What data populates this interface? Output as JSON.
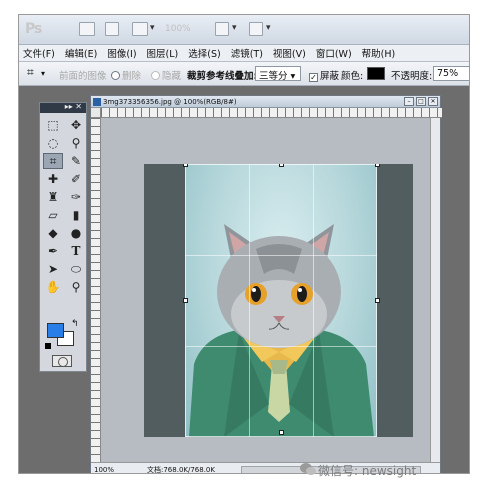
{
  "app": {
    "logo": "Ps",
    "zoom_value": "100%"
  },
  "menubar": {
    "items": [
      "文件(F)",
      "编辑(E)",
      "图像(I)",
      "图层(L)",
      "选择(S)",
      "滤镜(T)",
      "视图(V)",
      "窗口(W)",
      "帮助(H)"
    ]
  },
  "options": {
    "front_image_label": "前面的图像",
    "delete_label": "删除",
    "hide_label": "隐藏",
    "overlay_label": "裁剪参考线叠加:",
    "overlay_value": "三等分",
    "shield_label": "屏蔽",
    "color_label": "颜色:",
    "color_value": "#000000",
    "opacity_label": "不透明度:",
    "opacity_value": "75%"
  },
  "document": {
    "title": "3mg373356356.jpg @ 100%(RGB/8#)",
    "zoom": "100%",
    "doc_info": "文档:768.0K/768.0K"
  },
  "tools": {
    "foreground_color": "#2a7ee8",
    "background_color": "#ffffff",
    "icons": [
      "marquee-icon",
      "move-icon",
      "lasso-icon",
      "magic-wand-icon",
      "crop-icon",
      "eyedropper-icon",
      "healing-icon",
      "brush-icon",
      "stamp-icon",
      "history-brush-icon",
      "eraser-icon",
      "gradient-icon",
      "blur-icon",
      "dodge-icon",
      "pen-icon",
      "type-icon",
      "path-select-icon",
      "shape-icon",
      "hand-icon",
      "zoom-icon"
    ]
  },
  "watermark": {
    "text": "微信号: newsight"
  }
}
